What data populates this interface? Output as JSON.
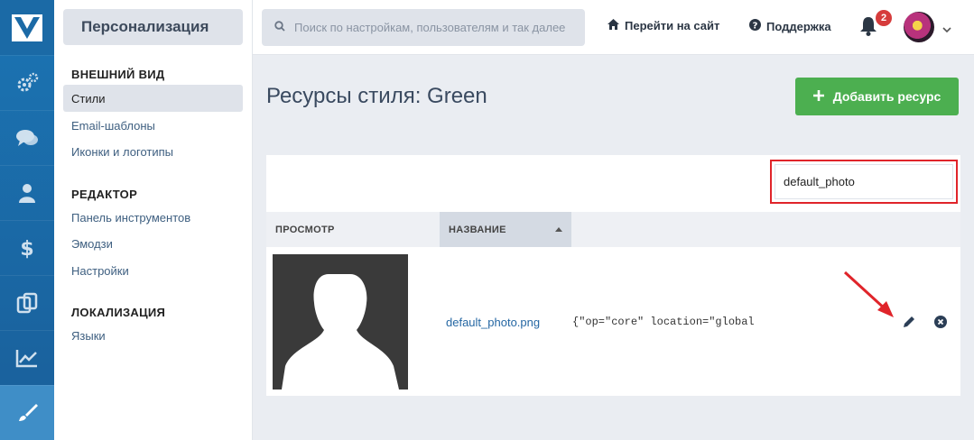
{
  "sidebar_rail": {
    "items": [
      {
        "icon": "logo-icon"
      },
      {
        "icon": "gears-icon"
      },
      {
        "icon": "chat-icon"
      },
      {
        "icon": "user-icon"
      },
      {
        "icon": "dollar-icon"
      },
      {
        "icon": "copy-icon"
      },
      {
        "icon": "chart-icon"
      },
      {
        "icon": "brush-icon",
        "active": true
      }
    ],
    "color": "#1b74b3",
    "active_color": "#3f8ec7"
  },
  "nav": {
    "title": "Персонализация",
    "sections": [
      {
        "heading": "ВНЕШНИЙ ВИД",
        "items": [
          "Стили",
          "Email-шаблоны",
          "Иконки и логотипы"
        ]
      },
      {
        "heading": "РЕДАКТОР",
        "items": [
          "Панель инструментов",
          "Эмодзи",
          "Настройки"
        ]
      },
      {
        "heading": "ЛОКАЛИЗАЦИЯ",
        "items": [
          "Языки"
        ]
      }
    ],
    "active_item": "Стили"
  },
  "topbar": {
    "search_placeholder": "Поиск по настройкам, пользователям и так далее",
    "go_to_site": "Перейти на сайт",
    "support": "Поддержка",
    "notifications_count": "2"
  },
  "main": {
    "title": "Ресурсы стиля: Green",
    "add_button": "Добавить ресурс",
    "add_button_color": "#4caf50",
    "filter_value": "default_photo",
    "table": {
      "headers": [
        "ПРОСМОТР",
        "НАЗВАНИЕ"
      ],
      "sorted_column": "НАЗВАНИЕ",
      "rows": [
        {
          "filename": "default_photo.png",
          "tag": "{resource=\"default_photo.png\" app=\"core\" location=\"global\"}",
          "tag_visible": "op=\"core\" location=\"global\"}"
        }
      ]
    }
  },
  "annotation": {
    "highlight_color": "#e0242a"
  }
}
